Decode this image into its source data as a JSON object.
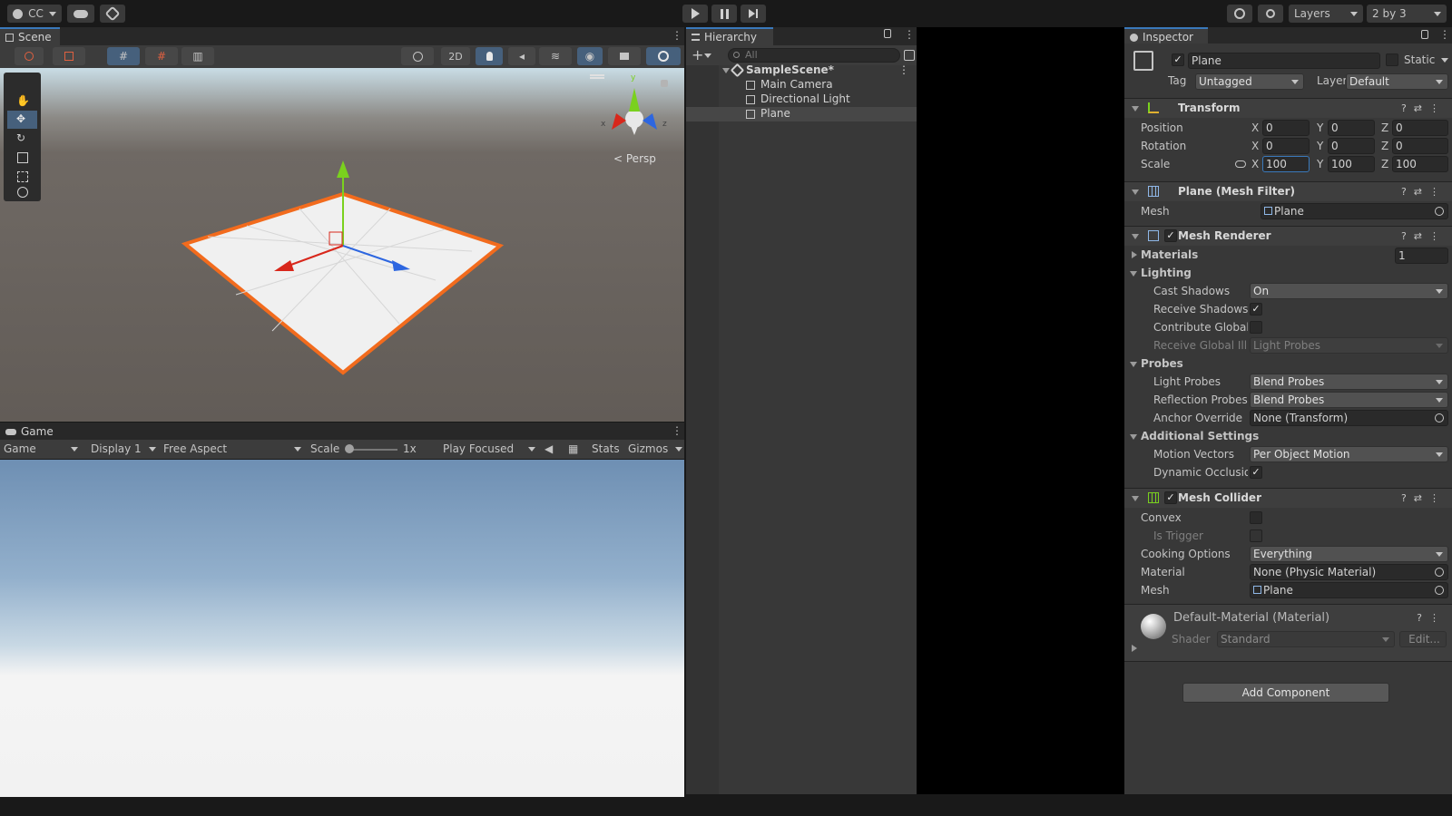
{
  "topbar": {
    "account": "CC",
    "layers": "Layers",
    "layout": "2 by 3"
  },
  "scene": {
    "tab": "Scene",
    "btn_2d": "2D",
    "persp": "Persp",
    "gizmo_x": "x",
    "gizmo_z": "z",
    "gizmo_y": "y"
  },
  "game": {
    "tab": "Game",
    "mode": "Game",
    "display": "Display 1",
    "aspect": "Free Aspect",
    "scale_label": "Scale",
    "scale_value": "1x",
    "play_focused": "Play Focused",
    "stats": "Stats",
    "gizmos": "Gizmos"
  },
  "hierarchy": {
    "tab": "Hierarchy",
    "search_placeholder": "All",
    "scene": "SampleScene*",
    "items": [
      "Main Camera",
      "Directional Light",
      "Plane"
    ]
  },
  "inspector": {
    "tab": "Inspector",
    "object_name": "Plane",
    "static_label": "Static",
    "tag_label": "Tag",
    "tag_value": "Untagged",
    "layer_label": "Layer",
    "layer_value": "Default",
    "transform": {
      "title": "Transform",
      "position_label": "Position",
      "rotation_label": "Rotation",
      "scale_label": "Scale",
      "position": [
        "0",
        "0",
        "0"
      ],
      "rotation": [
        "0",
        "0",
        "0"
      ],
      "scale": [
        "100",
        "100",
        "100"
      ],
      "x": "X",
      "y": "Y",
      "z": "Z"
    },
    "mesh_filter": {
      "title": "Plane (Mesh Filter)",
      "mesh_label": "Mesh",
      "mesh_value": "Plane"
    },
    "mesh_renderer": {
      "title": "Mesh Renderer",
      "materials_label": "Materials",
      "materials_count": "1",
      "lighting_label": "Lighting",
      "cast_shadows_label": "Cast Shadows",
      "cast_shadows_value": "On",
      "receive_shadows_label": "Receive Shadows",
      "contribute_gi_label": "Contribute Global I",
      "receive_gi_label": "Receive Global Illu",
      "receive_gi_value": "Light Probes",
      "probes_label": "Probes",
      "light_probes_label": "Light Probes",
      "light_probes_value": "Blend Probes",
      "reflection_probes_label": "Reflection Probes",
      "reflection_probes_value": "Blend Probes",
      "anchor_override_label": "Anchor Override",
      "anchor_override_value": "None (Transform)",
      "additional_label": "Additional Settings",
      "motion_vectors_label": "Motion Vectors",
      "motion_vectors_value": "Per Object Motion",
      "dynamic_occlusion_label": "Dynamic Occlusior"
    },
    "mesh_collider": {
      "title": "Mesh Collider",
      "convex_label": "Convex",
      "is_trigger_label": "Is Trigger",
      "cooking_label": "Cooking Options",
      "cooking_value": "Everything",
      "material_label": "Material",
      "material_value": "None (Physic Material)",
      "mesh_label": "Mesh",
      "mesh_value": "Plane"
    },
    "material": {
      "title": "Default-Material (Material)",
      "shader_label": "Shader",
      "shader_value": "Standard",
      "edit": "Edit..."
    },
    "add_component": "Add Component"
  },
  "colors": {
    "accent": "#3a79bb",
    "selection_outline": "#f26b1d",
    "panel": "#383838",
    "field": "#2a2a2a"
  }
}
